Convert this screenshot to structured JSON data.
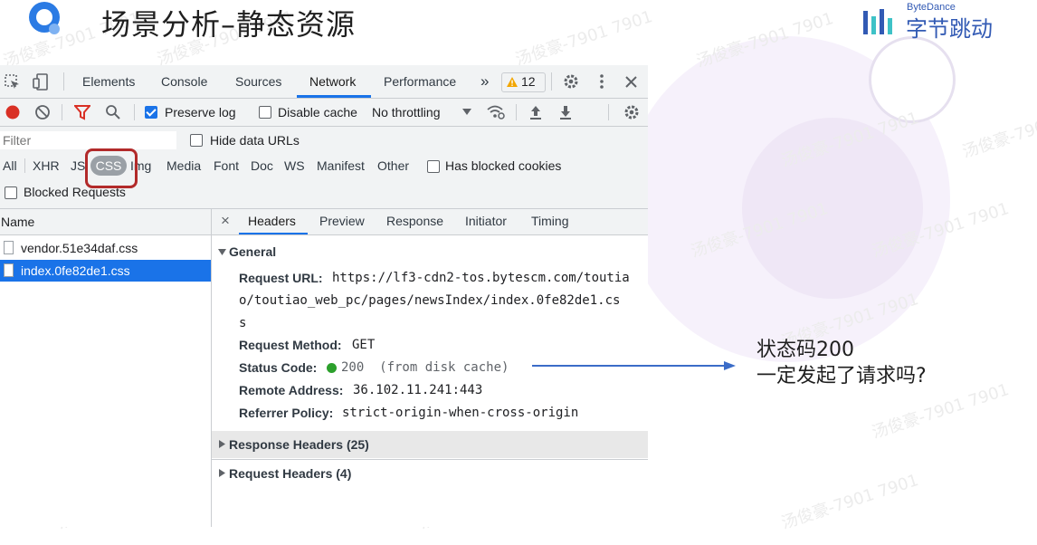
{
  "slide": {
    "title": "场景分析–静态资源",
    "brand_en": "ByteDance",
    "brand_cn": "字节跳动",
    "watermark": "汤俊豪-7901 7901",
    "annotation_line1": "状态码200",
    "annotation_line2": "一定发起了请求吗?"
  },
  "devtools": {
    "tabs": [
      "Elements",
      "Console",
      "Sources",
      "Network",
      "Performance"
    ],
    "active_tab": "Network",
    "more_tabs": "»",
    "warning_count": "12",
    "toolbar": {
      "preserve_log": "Preserve log",
      "disable_cache": "Disable cache",
      "throttling": "No throttling"
    },
    "filter": {
      "placeholder": "Filter",
      "hide_data_urls": "Hide data URLs",
      "types": [
        "All",
        "XHR",
        "JS",
        "CSS",
        "Img",
        "Media",
        "Font",
        "Doc",
        "WS",
        "Manifest",
        "Other"
      ],
      "active_type": "CSS",
      "has_blocked_cookies": "Has blocked cookies",
      "blocked_requests": "Blocked Requests"
    },
    "requests": {
      "column_name": "Name",
      "files": [
        "vendor.51e34daf.css",
        "index.0fe82de1.css"
      ],
      "selected": "index.0fe82de1.css"
    },
    "detail": {
      "close": "×",
      "tabs": [
        "Headers",
        "Preview",
        "Response",
        "Initiator",
        "Timing"
      ],
      "active_tab": "Headers",
      "general_title": "General",
      "request_url_label": "Request URL:",
      "request_url_line1": "https://lf3-cdn2-tos.bytescm.com/toutia",
      "request_url_line2": "o/toutiao_web_pc/pages/newsIndex/index.0fe82de1.cs",
      "request_url_line3": "s",
      "request_method_label": "Request Method:",
      "request_method": "GET",
      "status_code_label": "Status Code:",
      "status_code": "200  (from disk cache)",
      "status_color": "#2ca02c",
      "remote_address_label": "Remote Address:",
      "remote_address": "36.102.11.241:443",
      "referrer_policy_label": "Referrer Policy:",
      "referrer_policy": "strict-origin-when-cross-origin",
      "response_headers": "Response Headers (25)",
      "request_headers": "Request Headers (4)"
    }
  },
  "colors": {
    "accent": "#1a73e8",
    "highlight_border": "#b22a2a",
    "brand": "#325ab4",
    "arrow": "#3b6cc8"
  }
}
